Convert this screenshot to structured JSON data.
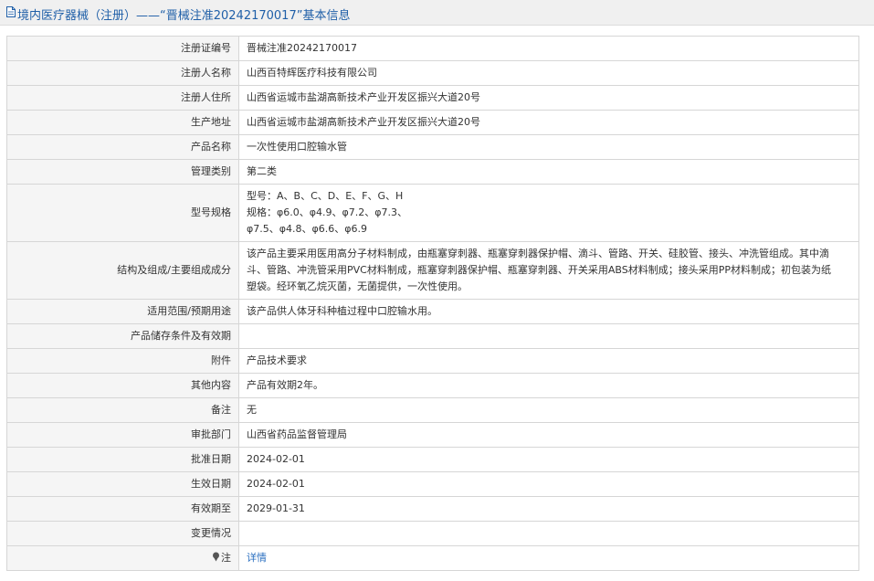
{
  "header": {
    "title": "境内医疗器械（注册）——“晋械注准20242170017”基本信息"
  },
  "rows": [
    {
      "label": "注册证编号",
      "value": "晋械注准20242170017"
    },
    {
      "label": "注册人名称",
      "value": "山西百特辉医疗科技有限公司"
    },
    {
      "label": "注册人住所",
      "value": "山西省运城市盐湖高新技术产业开发区振兴大道20号"
    },
    {
      "label": "生产地址",
      "value": "山西省运城市盐湖高新技术产业开发区振兴大道20号"
    },
    {
      "label": "产品名称",
      "value": "一次性使用口腔输水管"
    },
    {
      "label": "管理类别",
      "value": "第二类"
    },
    {
      "label": "型号规格",
      "lines": [
        "型号：A、B、C、D、E、F、G、H",
        "规格：φ6.0、φ4.9、φ7.2、φ7.3、",
        "φ7.5、φ4.8、φ6.6、φ6.9"
      ]
    },
    {
      "label": "结构及组成/主要组成成分",
      "lines": [
        "该产品主要采用医用高分子材料制成，由瓶塞穿刺器、瓶塞穿刺器保护帽、滴斗、管路、开关、硅胶管、接头、冲洗管组成。其中滴",
        "斗、管路、冲洗管采用PVC材料制成，瓶塞穿刺器保护帽、瓶塞穿刺器、开关采用ABS材料制成；接头采用PP材料制成；初包装为纸",
        "塑袋。经环氧乙烷灭菌，无菌提供，一次性使用。"
      ]
    },
    {
      "label": "适用范围/预期用途",
      "value": "该产品供人体牙科种植过程中口腔输水用。"
    },
    {
      "label": "产品储存条件及有效期",
      "value": ""
    },
    {
      "label": "附件",
      "value": "产品技术要求"
    },
    {
      "label": "其他内容",
      "value": "产品有效期2年。"
    },
    {
      "label": "备注",
      "value": "无"
    },
    {
      "label": "审批部门",
      "value": "山西省药品监督管理局"
    },
    {
      "label": "批准日期",
      "value": "2024-02-01"
    },
    {
      "label": "生效日期",
      "value": "2024-02-01"
    },
    {
      "label": "有效期至",
      "value": "2029-01-31"
    },
    {
      "label": "变更情况",
      "value": ""
    },
    {
      "label": "注",
      "value": "详情"
    }
  ]
}
